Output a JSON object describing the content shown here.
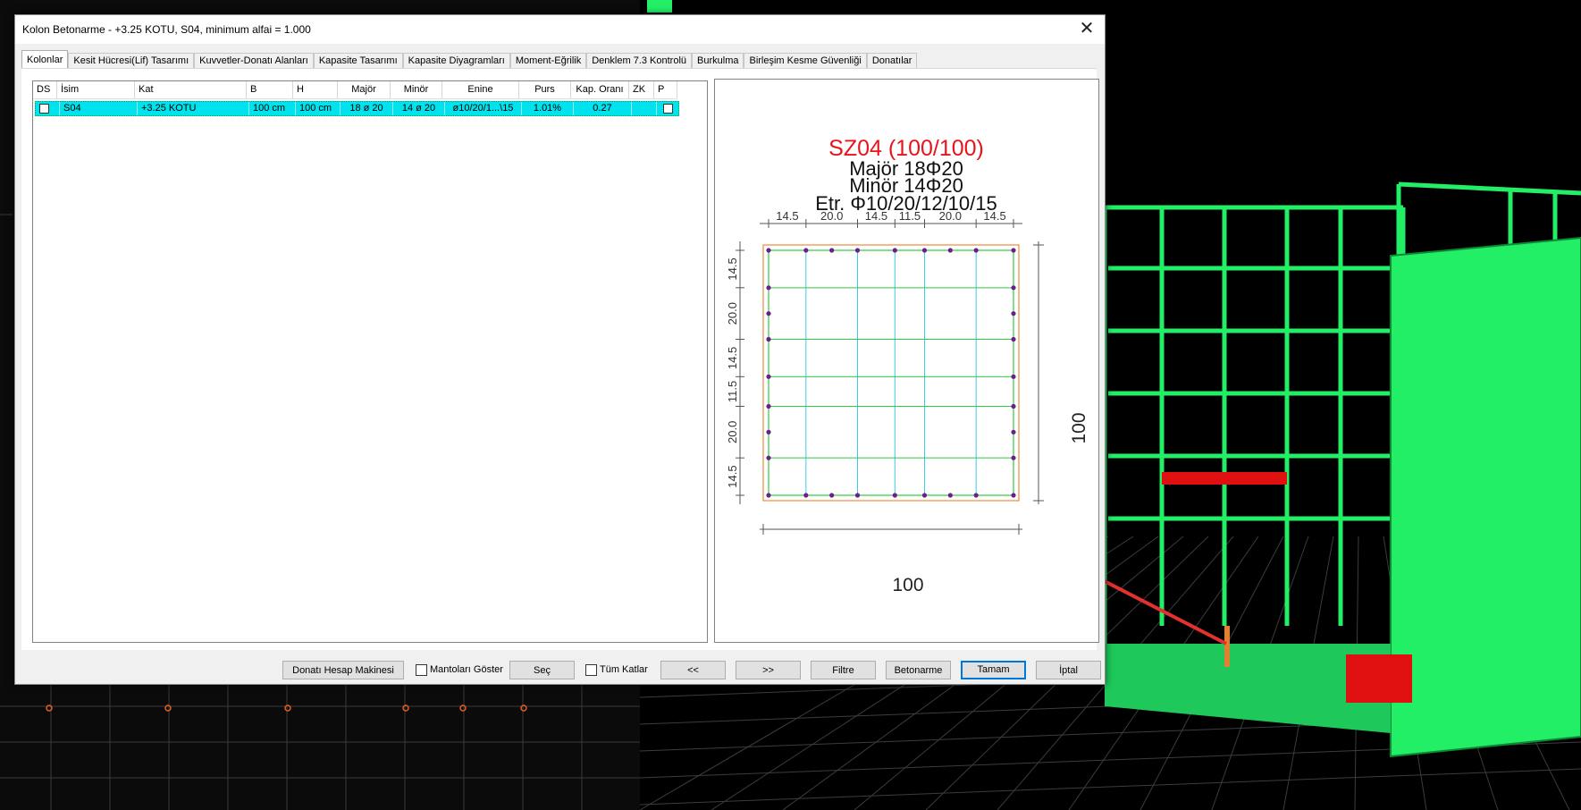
{
  "dialog": {
    "title": "Kolon Betonarme - +3.25 KOTU, S04, minimum alfai = 1.000",
    "close_glyph": "✕"
  },
  "tabs": [
    {
      "label": "Kolonlar"
    },
    {
      "label": "Kesit Hücresi(Lif) Tasarımı"
    },
    {
      "label": "Kuvvetler-Donatı Alanları"
    },
    {
      "label": "Kapasite Tasarımı"
    },
    {
      "label": "Kapasite Diyagramları"
    },
    {
      "label": "Moment-Eğrilik"
    },
    {
      "label": "Denklem 7.3 Kontrolü"
    },
    {
      "label": "Burkulma"
    },
    {
      "label": "Birleşim Kesme Güvenliği"
    },
    {
      "label": "Donatılar"
    }
  ],
  "table": {
    "headers": [
      "DS",
      "İsim",
      "Kat",
      "B",
      "H",
      "Majör",
      "Minör",
      "Enine",
      "Purs",
      "Kap. Oranı",
      "ZK",
      "P"
    ],
    "row": {
      "isim": "S04",
      "kat": "+3.25 KOTU",
      "b": "100 cm",
      "h": "100 cm",
      "major": "18 ø 20",
      "minor": "14 ø 20",
      "enine": "ø10/20/1...\\15",
      "purs": "1.01%",
      "kap_orani": "0.27",
      "zk": ""
    }
  },
  "section": {
    "name": "SZ04 (100/100)",
    "major": "Majör 18Φ20",
    "minor": "Minör 14Φ20",
    "etr": "Etr. Φ10/20/12/10/15",
    "top_dims": [
      "14.5",
      "20.0",
      "14.5",
      "11.5",
      "20.0",
      "14.5"
    ],
    "left_dims": [
      "14.5",
      "20.0",
      "14.5",
      "11.5",
      "20.0",
      "14.5"
    ],
    "width_label": "100",
    "height_label": "100",
    "colors": {
      "title": "#e8141c",
      "outline": "#f08a3c",
      "tie": "#2ecc40",
      "inner_tie": "#40c8e8",
      "bar": "#6a1f8a"
    }
  },
  "buttons": {
    "calculator": "Donatı Hesap Makinesi",
    "show_jackets": "Mantoları Göster",
    "select": "Seç",
    "all_floors": "Tüm Katlar",
    "prev": "<<",
    "next": ">>",
    "filter": "Filtre",
    "reinforce": "Betonarme",
    "ok": "Tamam",
    "cancel": "İptal"
  },
  "background": {
    "accent_green": "#22ee66",
    "highlight_red": "#e01010",
    "pointer_red": "#e53030"
  }
}
